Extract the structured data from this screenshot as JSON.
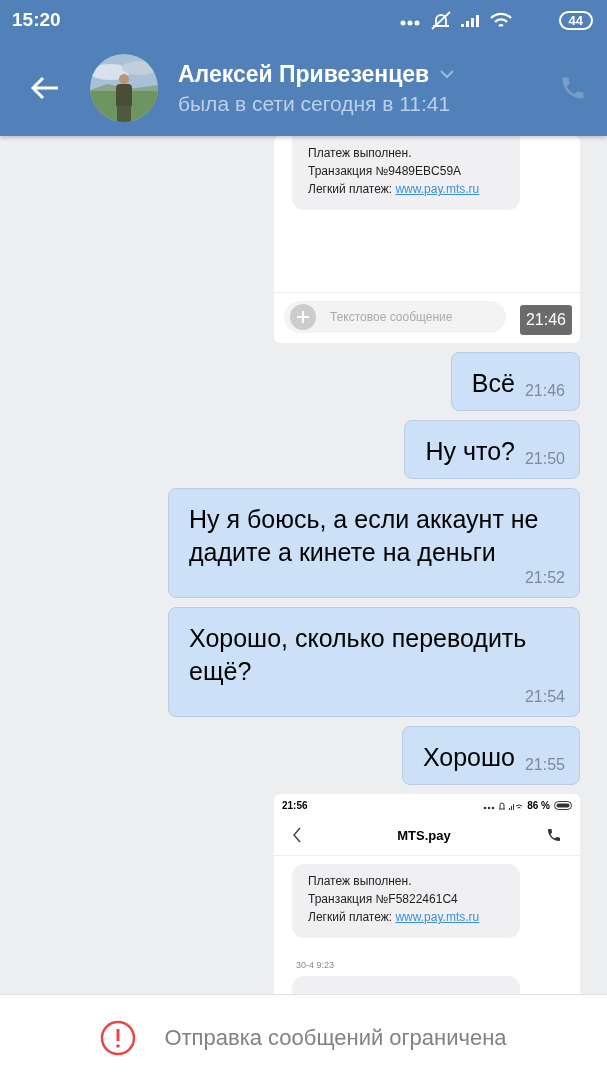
{
  "status_bar": {
    "time": "15:20",
    "battery": "44"
  },
  "header": {
    "name": "Алексей Привезенцев",
    "status": "была в сети сегодня в 11:41"
  },
  "messages": [
    {
      "kind": "screenshot_sms",
      "sms_lines": [
        "Платеж выполнен.",
        "Транзакция №9489EBC59A"
      ],
      "sms_link_label": "Легкий платеж:",
      "sms_link": "www.pay.mts.ru",
      "input_placeholder": "Текстовое сообщение",
      "time": "21:46"
    },
    {
      "kind": "text",
      "text": "Всё",
      "time": "21:46"
    },
    {
      "kind": "text",
      "text": "Ну что?",
      "time": "21:50"
    },
    {
      "kind": "text",
      "text": "Ну я боюсь, а если аккаунт не дадите а кинете на деньги",
      "time": "21:52"
    },
    {
      "kind": "text",
      "text": "Хорошо, сколько переводить ещё?",
      "time": "21:54"
    },
    {
      "kind": "text",
      "text": "Хорошо",
      "time": "21:55"
    },
    {
      "kind": "screenshot_thread",
      "status_time": "21:56",
      "status_battery": "86 %",
      "title": "MTS.pay",
      "sms_lines": [
        "Платеж выполнен.",
        "Транзакция №F5822461C4"
      ],
      "sms_link_label": "Легкий платеж:",
      "sms_link": "www.pay.mts.ru",
      "next_date": "30-4 9:23"
    }
  ],
  "footer": {
    "notice": "Отправка сообщений ограничена"
  }
}
